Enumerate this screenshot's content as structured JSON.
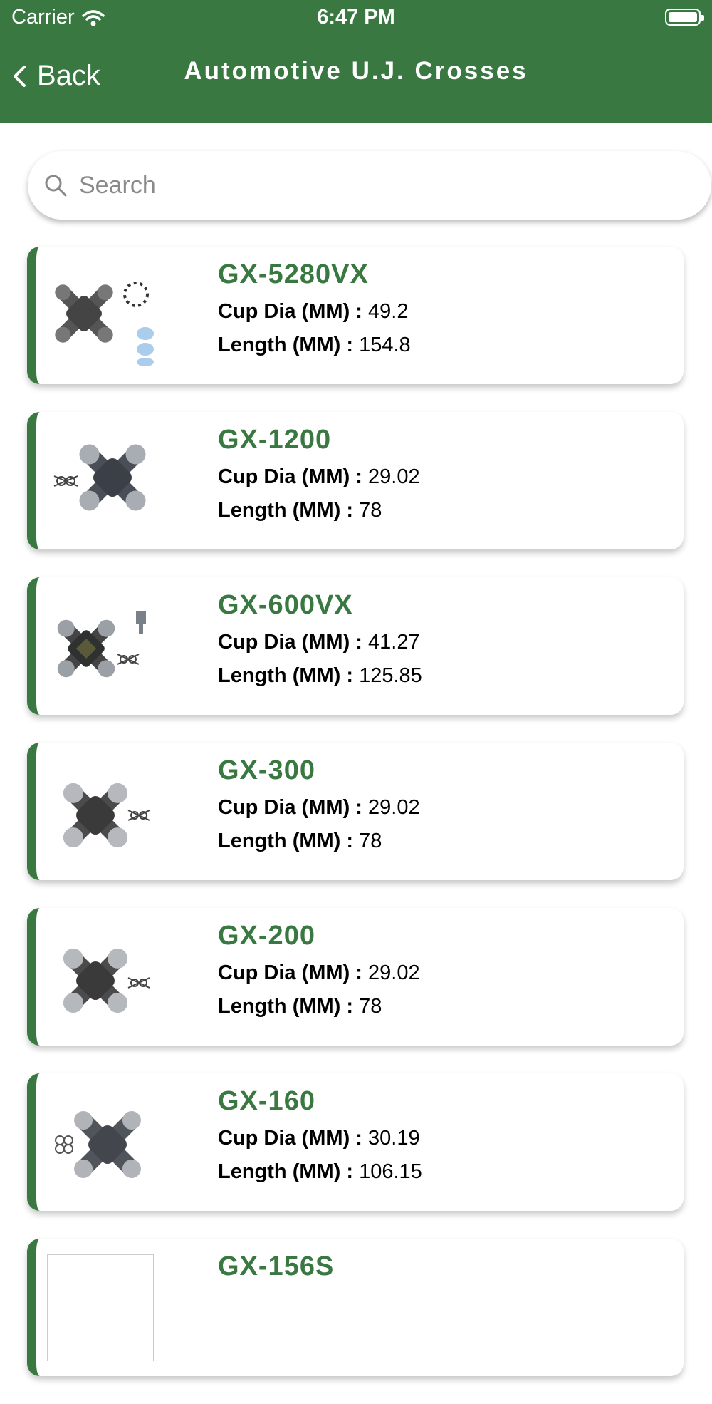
{
  "status_bar": {
    "carrier": "Carrier",
    "time": "6:47 PM"
  },
  "header": {
    "back_label": "Back",
    "title": "Automotive U.J. Crosses"
  },
  "search": {
    "placeholder": "Search"
  },
  "labels": {
    "cup_dia": "Cup Dia (MM) :",
    "length": "Length (MM) :"
  },
  "colors": {
    "brand_green": "#3a7842"
  },
  "products": [
    {
      "code": "GX-5280VX",
      "cup_dia": "49.2",
      "length": "154.8"
    },
    {
      "code": "GX-1200",
      "cup_dia": "29.02",
      "length": "78"
    },
    {
      "code": "GX-600VX",
      "cup_dia": "41.27",
      "length": "125.85"
    },
    {
      "code": "GX-300",
      "cup_dia": "29.02",
      "length": "78"
    },
    {
      "code": "GX-200",
      "cup_dia": "29.02",
      "length": "78"
    },
    {
      "code": "GX-160",
      "cup_dia": "30.19",
      "length": "106.15"
    },
    {
      "code": "GX-156S",
      "cup_dia": "",
      "length": ""
    }
  ]
}
